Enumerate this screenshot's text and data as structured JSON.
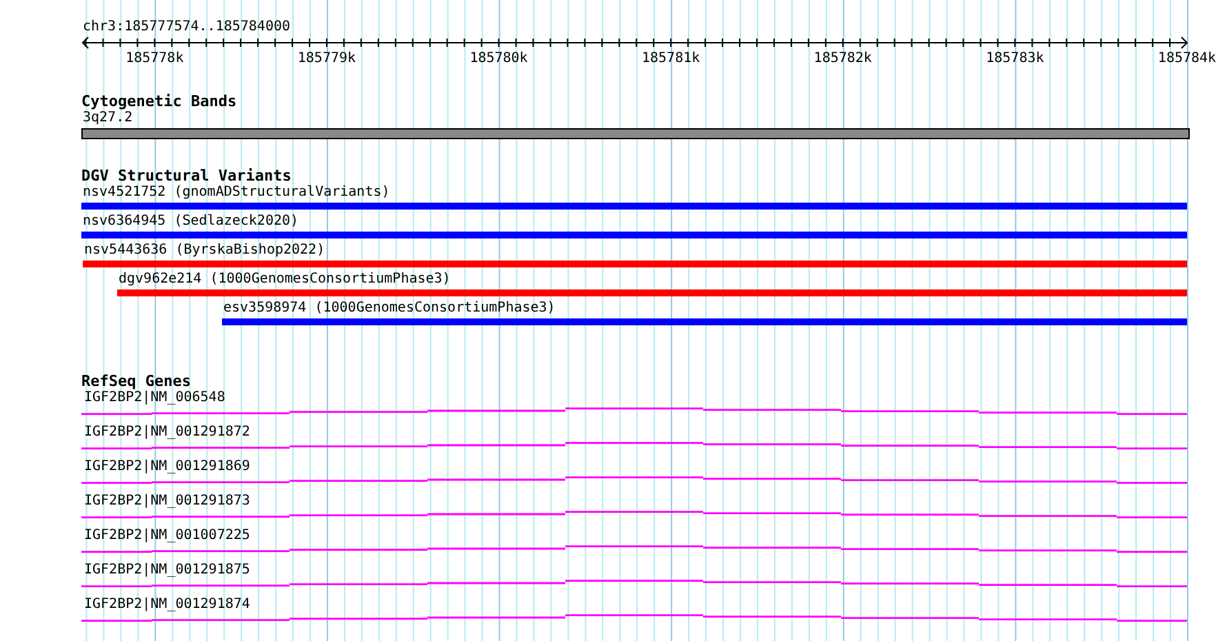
{
  "ruler": {
    "location": "chr3:185777574..185784000",
    "tick_labels": [
      "185778k",
      "185779k",
      "185780k",
      "185781k",
      "185782k",
      "185783k",
      "185784k"
    ]
  },
  "cytogenetic_bands": {
    "title": "Cytogenetic Bands",
    "band": {
      "label": "3q27.2"
    }
  },
  "dgv_structural_variants": {
    "title": "DGV Structural Variants",
    "features": [
      {
        "label": "nsv4521752 (gnomADStructuralVariants)",
        "color": "#0000ff"
      },
      {
        "label": "nsv6364945 (Sedlazeck2020)",
        "color": "#0000ff"
      },
      {
        "label": "nsv5443636 (ByrskaBishop2022)",
        "color": "#ff0000"
      },
      {
        "label": "dgv962e214 (1000GenomesConsortiumPhase3)",
        "color": "#ff0000"
      },
      {
        "label": "esv3598974 (1000GenomesConsortiumPhase3)",
        "color": "#0000ff"
      }
    ]
  },
  "refseq_genes": {
    "title": "RefSeq Genes",
    "transcripts": [
      {
        "label": "IGF2BP2|NM_006548"
      },
      {
        "label": "IGF2BP2|NM_001291872"
      },
      {
        "label": "IGF2BP2|NM_001291869"
      },
      {
        "label": "IGF2BP2|NM_001291873"
      },
      {
        "label": "IGF2BP2|NM_001007225"
      },
      {
        "label": "IGF2BP2|NM_001291875"
      },
      {
        "label": "IGF2BP2|NM_001291874"
      }
    ]
  }
}
